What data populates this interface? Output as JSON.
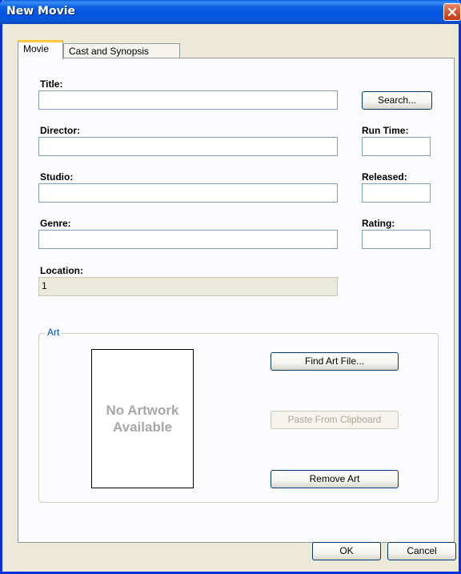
{
  "window": {
    "title": "New Movie"
  },
  "tabs": [
    "Movie",
    "Cast and Synopsis"
  ],
  "form": {
    "title_label": "Title:",
    "title_value": "",
    "director_label": "Director:",
    "director_value": "",
    "studio_label": "Studio:",
    "studio_value": "",
    "genre_label": "Genre:",
    "genre_value": "",
    "location_label": "Location:",
    "location_value": "1",
    "runtime_label": "Run Time:",
    "runtime_value": "",
    "released_label": "Released:",
    "released_value": "",
    "rating_label": "Rating:",
    "rating_value": ""
  },
  "buttons": {
    "search": "Search...",
    "find_art": "Find Art File...",
    "paste": "Paste From Clipboard",
    "remove_art": "Remove Art",
    "ok": "OK",
    "cancel": "Cancel"
  },
  "art": {
    "group_label": "Art",
    "placeholder": "No Artwork Available"
  },
  "icons": {
    "close": "close-icon"
  }
}
